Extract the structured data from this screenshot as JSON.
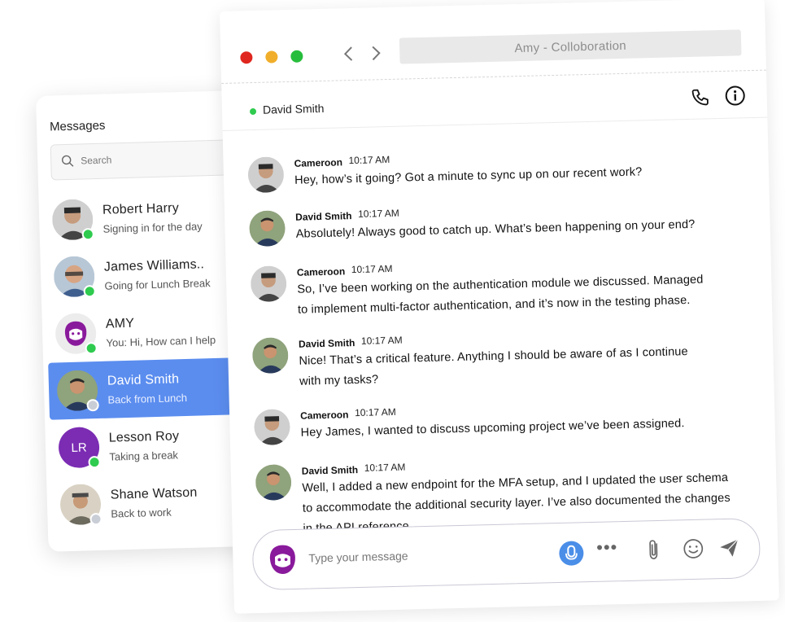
{
  "window": {
    "address_title": "Amy - Colloboration"
  },
  "sidebar": {
    "title": "Messages",
    "search_placeholder": "Search",
    "contacts": [
      {
        "name": "Robert Harry",
        "sub": "Signing in for the day",
        "status": "online"
      },
      {
        "name": "James Williams..",
        "sub": "Going for Lunch Break",
        "status": "online"
      },
      {
        "name": "AMY",
        "sub": "You: Hi, How can I help",
        "status": "online"
      },
      {
        "name": "David Smith",
        "sub": "Back from Lunch",
        "status": "away",
        "active": true
      },
      {
        "name": "Lesson Roy",
        "sub": "Taking a break",
        "status": "online",
        "initials": "LR"
      },
      {
        "name": "Shane Watson",
        "sub": "Back to work",
        "status": "away"
      }
    ]
  },
  "chat": {
    "header_name": "David Smith",
    "messages": [
      {
        "sender": "Cameroon",
        "time": "10:17 AM",
        "lines": [
          "Hey, how’s it going? Got a minute to sync up on our recent work?"
        ]
      },
      {
        "sender": "David Smith",
        "time": "10:17 AM",
        "lines": [
          "Absolutely! Always good to catch up. What’s been happening on your end?"
        ]
      },
      {
        "sender": "Cameroon",
        "time": "10:17 AM",
        "lines": [
          "So, I’ve been working on the authentication module we discussed. Managed",
          "to implement multi-factor authentication, and it’s now in the testing phase."
        ]
      },
      {
        "sender": "David Smith",
        "time": "10:17 AM",
        "lines": [
          "Nice! That’s a critical feature. Anything I should be aware of as I continue",
          "with my tasks?"
        ]
      },
      {
        "sender": "Cameroon",
        "time": "10:17 AM",
        "lines": [
          "Hey James, I wanted to discuss upcoming project we’ve been assigned."
        ]
      },
      {
        "sender": "David Smith",
        "time": "10:17 AM",
        "lines": [
          "Well, I added a new endpoint for the MFA setup, and I updated the user schema",
          "to accommodate the additional security layer. I’ve also documented the changes",
          "in the API reference."
        ]
      }
    ],
    "composer_placeholder": "Type your message"
  },
  "colors": {
    "active_contact": "#5b8def",
    "online": "#2fcb4f",
    "mic": "#4a8ee8",
    "lr_avatar": "#7b2cb3",
    "amy_brand": "#8a1a9c"
  },
  "icons": [
    "search-icon",
    "phone-icon",
    "info-icon",
    "microphone-icon",
    "more-icon",
    "paperclip-icon",
    "emoji-icon",
    "send-icon",
    "amy-bot-icon",
    "chevron-left-icon",
    "chevron-right-icon"
  ]
}
